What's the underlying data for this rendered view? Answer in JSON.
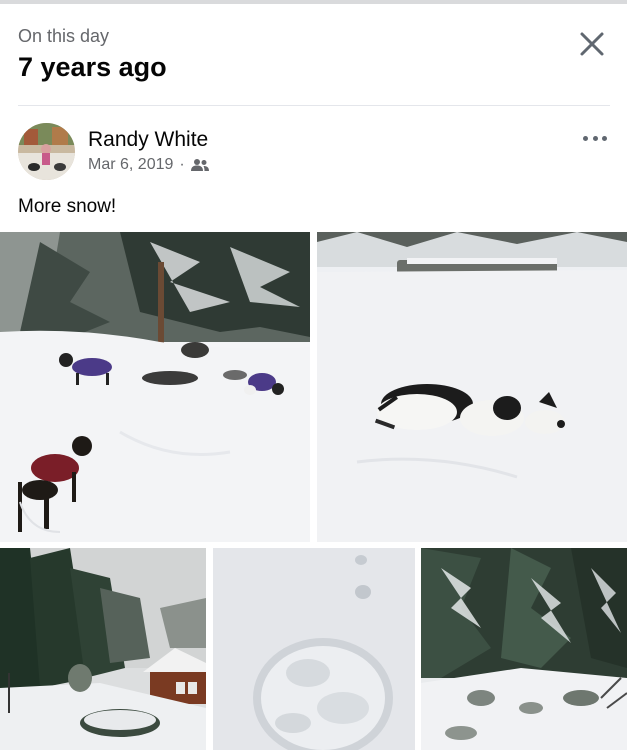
{
  "memory": {
    "label": "On this day",
    "heading": "7 years ago"
  },
  "post": {
    "author": "Randy White",
    "date": "Mar 6, 2019",
    "separator": "·",
    "audience_icon": "friends-icon",
    "text": "More snow!"
  },
  "icons": {
    "close": "close-icon",
    "more": "more-options-icon"
  },
  "photos": [
    {
      "name": "photo-dogs-in-snow-yard"
    },
    {
      "name": "photo-dog-rolling-in-snow"
    },
    {
      "name": "photo-snowy-cabin"
    },
    {
      "name": "photo-snow-closeup"
    },
    {
      "name": "photo-snowy-garden"
    }
  ],
  "colors": {
    "text_primary": "#050505",
    "text_secondary": "#65676b",
    "divider": "#e4e6eb"
  }
}
